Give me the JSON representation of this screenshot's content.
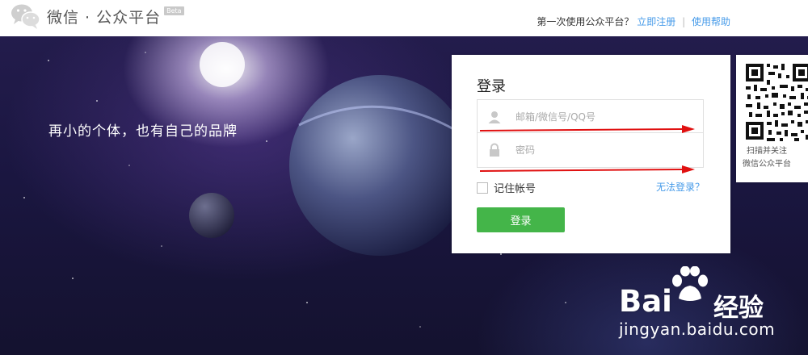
{
  "header": {
    "logo_title": "微信 · 公众平台",
    "beta_badge": "Beta",
    "first_time_text": "第一次使用公众平台？",
    "register_link": "立即注册",
    "separator": "|",
    "help_link": "使用帮助"
  },
  "banner": {
    "tagline": "再小的个体，也有自己的品牌"
  },
  "login": {
    "title": "登录",
    "account_placeholder": "邮箱/微信号/QQ号",
    "password_placeholder": "密码",
    "remember_label": "记住帐号",
    "forgot_link": "无法登录？",
    "submit_label": "登录"
  },
  "qr": {
    "line1": "扫描并关注",
    "line2": "微信公众平台"
  },
  "watermark": {
    "brand": "Bai",
    "brand_cn": "经验",
    "url": "jingyan.baidu.com"
  },
  "colors": {
    "accent_green": "#44b549",
    "link_blue": "#459ae9",
    "annotation_red": "#e01010"
  },
  "icons": [
    "wechat-logo-icon",
    "user-icon",
    "lock-icon",
    "qr-code-icon",
    "paw-icon",
    "arrow-icon"
  ]
}
